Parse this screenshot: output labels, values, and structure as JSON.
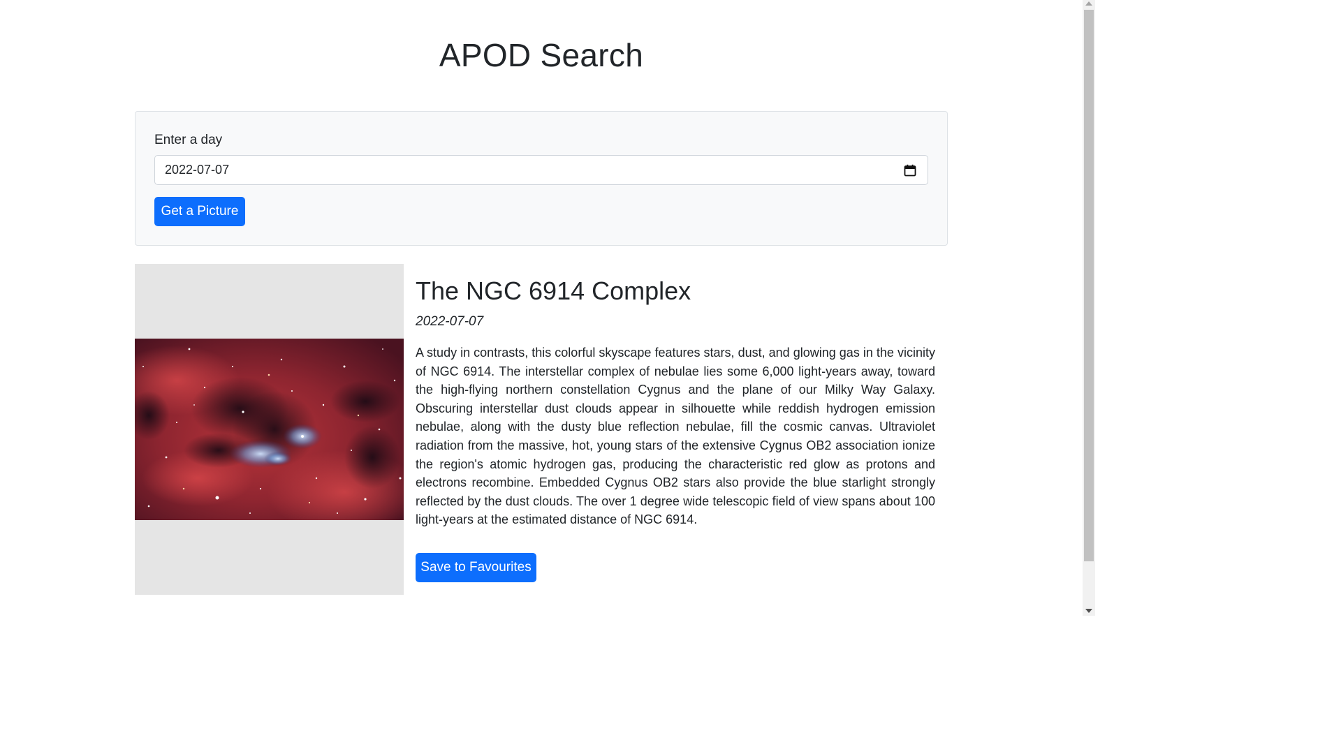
{
  "header": {
    "title": "APOD Search"
  },
  "search": {
    "label": "Enter a day",
    "date_value": "2022-07-07",
    "submit_label": "Get a Picture"
  },
  "result": {
    "title": "The NGC 6914 Complex",
    "date": "2022-07-07",
    "explanation": "A study in contrasts, this colorful skyscape features stars, dust, and glowing gas in the vicinity of NGC 6914. The interstellar complex of nebulae lies some 6,000 light-years away, toward the high-flying northern constellation Cygnus and the plane of our Milky Way Galaxy. Obscuring interstellar dust clouds appear in silhouette while reddish hydrogen emission nebulae, along with the dusty blue reflection nebulae, fill the cosmic canvas. Ultraviolet radiation from the massive, hot, young stars of the extensive Cygnus OB2 association ionize the region's atomic hydrogen gas, producing the characteristic red glow as protons and electrons recombine. Embedded Cygnus OB2 stars also provide the blue starlight strongly reflected by the dust clouds. The over 1 degree wide telescopic field of view spans about 100 light-years at the estimated distance of NGC 6914.",
    "save_label": "Save to Favourites",
    "image_icon": "nebula-image"
  },
  "colors": {
    "primary": "#0d6efd",
    "card_bg": "#f8f9fa",
    "image_panel_bg": "#e5e5e5"
  }
}
